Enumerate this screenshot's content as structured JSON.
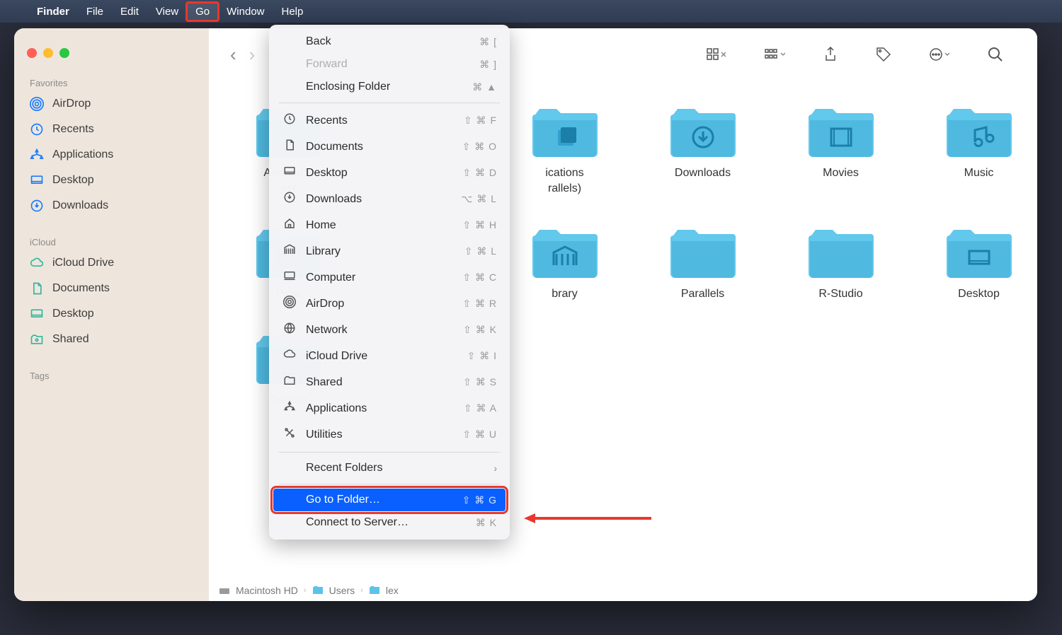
{
  "menubar": {
    "apple": "",
    "items": [
      "Finder",
      "File",
      "Edit",
      "View",
      "Go",
      "Window",
      "Help"
    ],
    "highlighted": "Go"
  },
  "sidebar": {
    "sections": [
      {
        "title": "Favorites",
        "items": [
          {
            "icon": "airdrop",
            "label": "AirDrop"
          },
          {
            "icon": "clock",
            "label": "Recents"
          },
          {
            "icon": "apps",
            "label": "Applications"
          },
          {
            "icon": "desktop",
            "label": "Desktop"
          },
          {
            "icon": "download",
            "label": "Downloads"
          }
        ]
      },
      {
        "title": "iCloud",
        "items": [
          {
            "icon": "cloud",
            "label": "iCloud Drive"
          },
          {
            "icon": "doc",
            "label": "Documents"
          },
          {
            "icon": "desktop",
            "label": "Desktop"
          },
          {
            "icon": "shared",
            "label": "Shared"
          }
        ]
      },
      {
        "title": "Tags",
        "items": []
      }
    ]
  },
  "folders": [
    {
      "label": "AndroidStudioProjects",
      "glyph": "none",
      "display": "AndroidSt\nect"
    },
    {
      "label": "Applications (Parallels)",
      "glyph": "app",
      "display": "ications\nrallels)"
    },
    {
      "label": "Downloads",
      "glyph": "download",
      "display": "Downloads"
    },
    {
      "label": "Movies",
      "glyph": "movie",
      "display": "Movies"
    },
    {
      "label": "Music",
      "glyph": "music",
      "display": "Music"
    },
    {
      "label": "Pictures",
      "glyph": "picture",
      "display": "Pictu"
    },
    {
      "label": "Library",
      "glyph": "library",
      "display": "brary"
    },
    {
      "label": "Parallels",
      "glyph": "none",
      "display": "Parallels"
    },
    {
      "label": "R-Studio",
      "glyph": "none",
      "display": "R-Studio"
    },
    {
      "label": "Desktop",
      "glyph": "desktop",
      "display": "Desktop"
    },
    {
      "label": "Documents",
      "glyph": "doc",
      "display": "Docum"
    }
  ],
  "menu": {
    "groups": [
      [
        {
          "label": "Back",
          "shortcut": "⌘ [",
          "disabled": false
        },
        {
          "label": "Forward",
          "shortcut": "⌘ ]",
          "disabled": true
        },
        {
          "label": "Enclosing Folder",
          "shortcut": "⌘ ▲",
          "disabled": false
        }
      ],
      [
        {
          "icon": "clock",
          "label": "Recents",
          "shortcut": "⇧ ⌘ F"
        },
        {
          "icon": "doc",
          "label": "Documents",
          "shortcut": "⇧ ⌘ O"
        },
        {
          "icon": "desktop",
          "label": "Desktop",
          "shortcut": "⇧ ⌘ D"
        },
        {
          "icon": "download",
          "label": "Downloads",
          "shortcut": "⌥ ⌘ L"
        },
        {
          "icon": "home",
          "label": "Home",
          "shortcut": "⇧ ⌘ H"
        },
        {
          "icon": "library",
          "label": "Library",
          "shortcut": "⇧ ⌘ L"
        },
        {
          "icon": "computer",
          "label": "Computer",
          "shortcut": "⇧ ⌘ C"
        },
        {
          "icon": "airdrop",
          "label": "AirDrop",
          "shortcut": "⇧ ⌘ R"
        },
        {
          "icon": "network",
          "label": "Network",
          "shortcut": "⇧ ⌘ K"
        },
        {
          "icon": "cloud",
          "label": "iCloud Drive",
          "shortcut": "⇧ ⌘ I"
        },
        {
          "icon": "shared",
          "label": "Shared",
          "shortcut": "⇧ ⌘ S"
        },
        {
          "icon": "apps",
          "label": "Applications",
          "shortcut": "⇧ ⌘ A"
        },
        {
          "icon": "utilities",
          "label": "Utilities",
          "shortcut": "⇧ ⌘ U"
        }
      ],
      [
        {
          "label": "Recent Folders",
          "submenu": true
        }
      ],
      [
        {
          "label": "Go to Folder…",
          "shortcut": "⇧ ⌘ G",
          "highlighted": true
        },
        {
          "label": "Connect to Server…",
          "shortcut": "⌘ K"
        }
      ]
    ]
  },
  "pathbar": {
    "segments": [
      "Macintosh HD",
      "Users",
      "lex"
    ]
  },
  "annotations": {
    "box_menubar_go": true,
    "box_go_to_folder": true,
    "arrow_to_go_to_folder": true
  }
}
